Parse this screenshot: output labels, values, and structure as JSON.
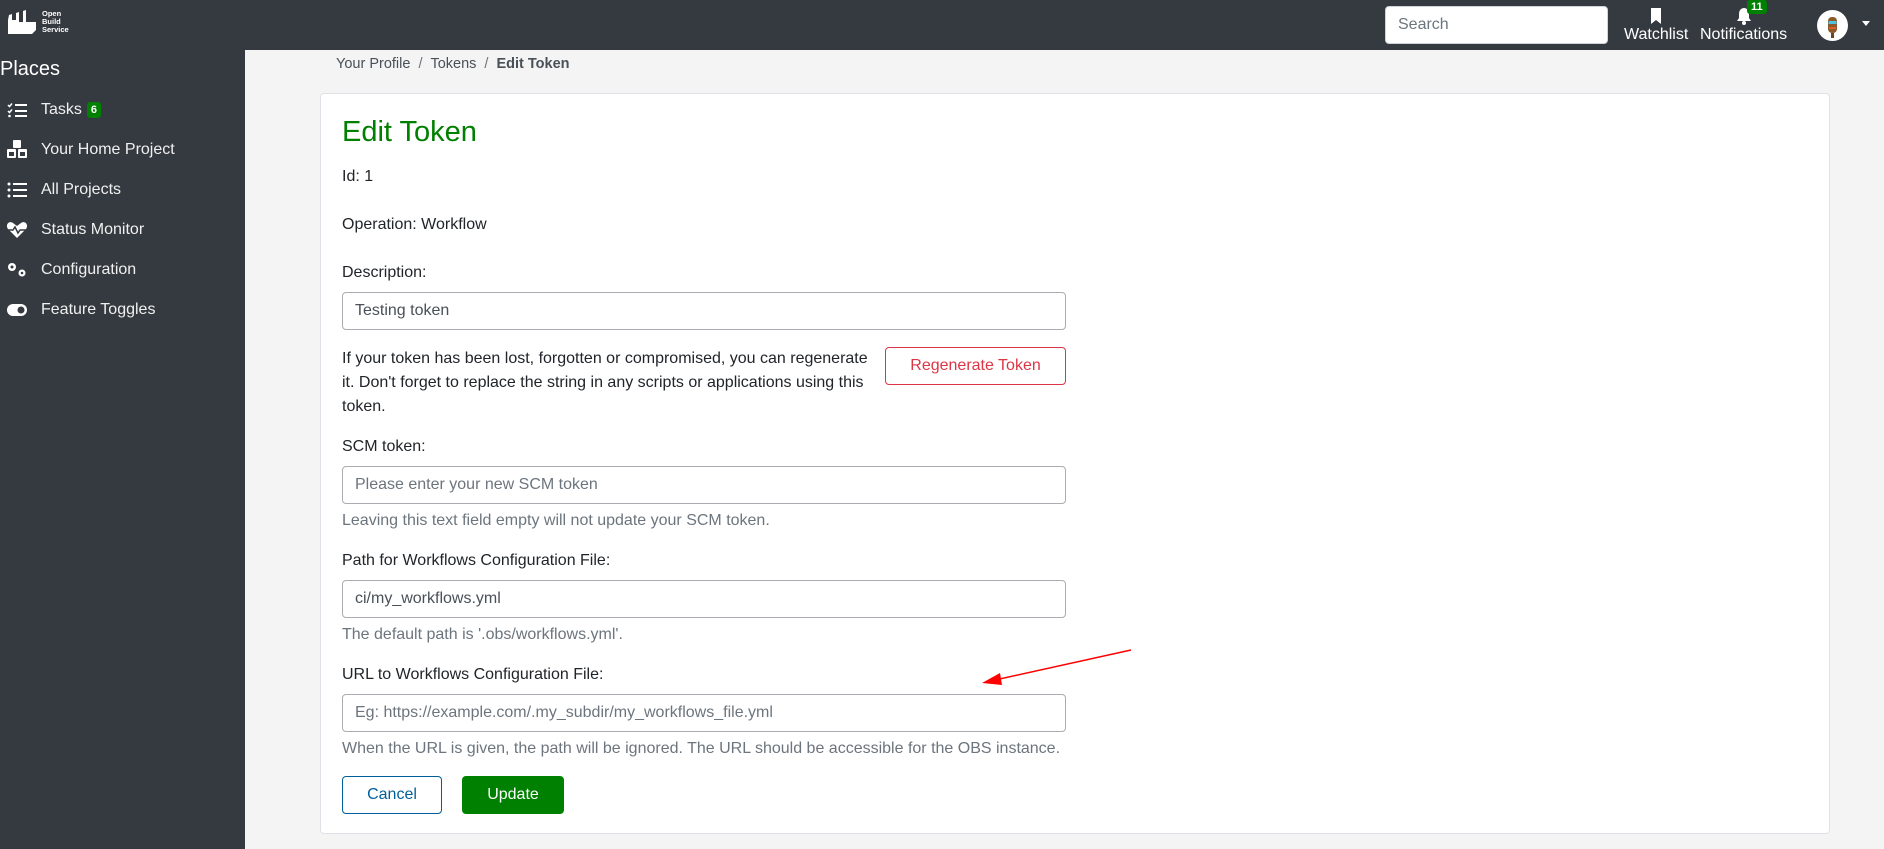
{
  "header": {
    "logo_text": [
      "Open",
      "Build",
      "Service"
    ],
    "search_placeholder": "Search",
    "watchlist_label": "Watchlist",
    "notifications_label": "Notifications",
    "notifications_count": "11"
  },
  "sidebar": {
    "title": "Places",
    "items": [
      {
        "label": "Tasks",
        "icon": "tasks-icon",
        "badge": "6"
      },
      {
        "label": "Your Home Project",
        "icon": "cubes-icon"
      },
      {
        "label": "All Projects",
        "icon": "list-icon"
      },
      {
        "label": "Status Monitor",
        "icon": "heartbeat-icon"
      },
      {
        "label": "Configuration",
        "icon": "cogs-icon"
      },
      {
        "label": "Feature Toggles",
        "icon": "toggle-icon"
      }
    ]
  },
  "breadcrumb": {
    "items": [
      "Your Profile",
      "Tokens"
    ],
    "separator": "/",
    "active": "Edit Token"
  },
  "form": {
    "title": "Edit Token",
    "id_text": "Id: 1",
    "operation_text": "Operation: Workflow",
    "description_label": "Description:",
    "description_value": "Testing token",
    "regenerate_text": "If your token has been lost, forgotten or compromised, you can regenerate it. Don't forget to replace the string in any scripts or applications using this token.",
    "regenerate_button": "Regenerate Token",
    "scm_label": "SCM token:",
    "scm_placeholder": "Please enter your new SCM token",
    "scm_help": "Leaving this text field empty will not update your SCM token.",
    "path_label": "Path for Workflows Configuration File:",
    "path_value": "ci/my_workflows.yml",
    "path_help": "The default path is '.obs/workflows.yml'.",
    "url_label": "URL to Workflows Configuration File:",
    "url_placeholder": "Eg: https://example.com/.my_subdir/my_workflows_file.yml",
    "url_help": "When the URL is given, the path will be ignored. The URL should be accessible for the OBS instance.",
    "cancel_button": "Cancel",
    "update_button": "Update"
  },
  "annotation": {
    "arrow_color": "#ff0000"
  }
}
